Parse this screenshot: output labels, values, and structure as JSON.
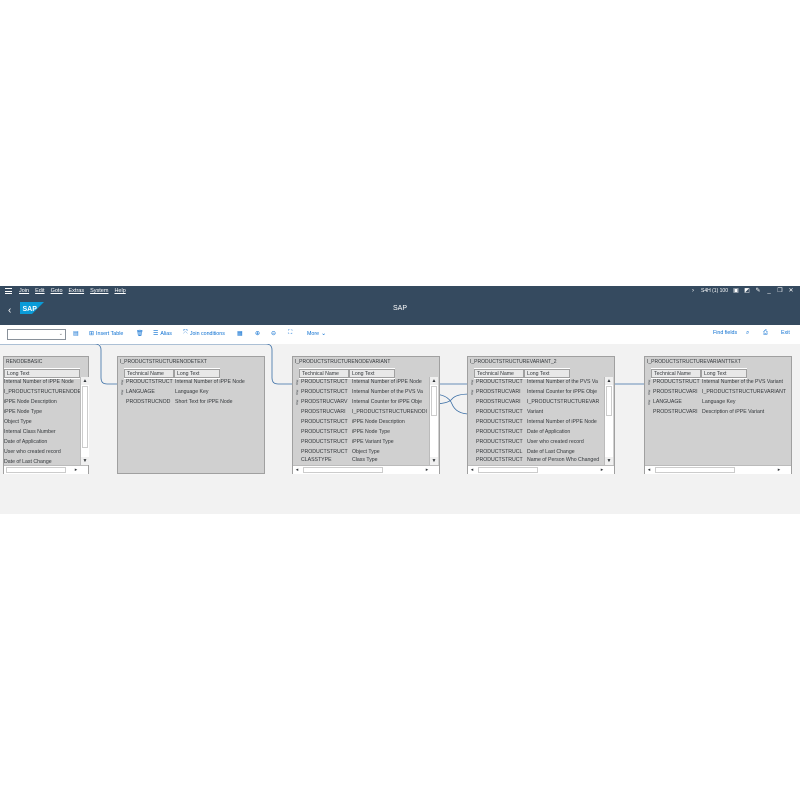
{
  "menubar": {
    "items": [
      "Join",
      "Edit",
      "Goto",
      "Extras",
      "System",
      "Help"
    ],
    "system_info": "S4H (1) 100",
    "colors": {
      "shell": "#354a5f",
      "text": "#ffffff"
    }
  },
  "titlebar": {
    "logo_text": "SAP",
    "title": "SAP"
  },
  "toolbar": {
    "insert_table": "Insert Table",
    "alias": "Alias",
    "join_conditions": "Join conditions",
    "more": "More",
    "find_fields": "Find fields",
    "exit": "Exit"
  },
  "tables": [
    {
      "name": "RENODEBASIC",
      "col1": "",
      "col2": "Long Text",
      "rows": [
        {
          "key": false,
          "tech": "",
          "text": "Internal Number of iPPE Node"
        },
        {
          "key": false,
          "tech": "",
          "text": "I_PRODUCTSTRUCTURENODE"
        },
        {
          "key": false,
          "tech": "",
          "text": "iPPE Node Description"
        },
        {
          "key": false,
          "tech": "",
          "text": "iPPE Node Type"
        },
        {
          "key": false,
          "tech": "",
          "text": "Object Type"
        },
        {
          "key": false,
          "tech": "",
          "text": "Internal Class Number"
        },
        {
          "key": false,
          "tech": "",
          "text": "Date of Application"
        },
        {
          "key": false,
          "tech": "",
          "text": "User who created record"
        },
        {
          "key": false,
          "tech": "",
          "text": "Date of Last Change"
        }
      ]
    },
    {
      "name": "I_PRODUCTSTRUCTURENODETEXT",
      "col1": "Technical Name",
      "col2": "Long Text",
      "rows": [
        {
          "key": true,
          "tech": "PRODUCTSTRUCT",
          "text": "Internal Number of iPPE Node"
        },
        {
          "key": true,
          "tech": "LANGUAGE",
          "text": "Language Key"
        },
        {
          "key": false,
          "tech": "PRODSTRUCNOD",
          "text": "Short Text for iPPE Node"
        }
      ]
    },
    {
      "name": "I_PRODUCTSTRUCTURENODEVARIANT",
      "col1": "Technical Name",
      "col2": "Long Text",
      "rows": [
        {
          "key": true,
          "tech": "PRODUCTSTRUCT",
          "text": "Internal Number of iPPE Node"
        },
        {
          "key": true,
          "tech": "PRODUCTSTRUCT",
          "text": "Internal Number of the PVS Va"
        },
        {
          "key": true,
          "tech": "PRODSTRUCVARV",
          "text": "Internal Counter for iPPE Obje"
        },
        {
          "key": false,
          "tech": "PRODSTRUCVARI",
          "text": "I_PRODUCTSTRUCTURENODI"
        },
        {
          "key": false,
          "tech": "PRODUCTSTRUCT",
          "text": "iPPE Node Description"
        },
        {
          "key": false,
          "tech": "PRODUCTSTRUCT",
          "text": "iPPE Node Type"
        },
        {
          "key": false,
          "tech": "PRODUCTSTRUCT",
          "text": "iPPE Variant Type"
        },
        {
          "key": false,
          "tech": "PRODUCTSTRUCT",
          "text": "Object Type"
        },
        {
          "key": false,
          "tech": "CLASSTYPE",
          "text": "Class Type"
        }
      ]
    },
    {
      "name": "I_PRODUCTSTRUCTUREVARIANT_2",
      "col1": "Technical Name",
      "col2": "Long Text",
      "rows": [
        {
          "key": true,
          "tech": "PRODUCTSTRUCT",
          "text": "Internal Number of the PVS Va"
        },
        {
          "key": true,
          "tech": "PRODSTRUCVARI",
          "text": "Internal Counter for iPPE Obje"
        },
        {
          "key": false,
          "tech": "PRODSTRUCVARI",
          "text": "I_PRODUCTSTRUCTUREVAR"
        },
        {
          "key": false,
          "tech": "PRODUCTSTRUCT",
          "text": "Variant"
        },
        {
          "key": false,
          "tech": "PRODUCTSTRUCT",
          "text": "Internal Number of iPPE Node"
        },
        {
          "key": false,
          "tech": "PRODUCTSTRUCT",
          "text": "Date of Application"
        },
        {
          "key": false,
          "tech": "PRODUCTSTRUCT",
          "text": "User who created record"
        },
        {
          "key": false,
          "tech": "PRODUCTSTRUCL",
          "text": "Date of Last Change"
        },
        {
          "key": false,
          "tech": "PRODUCTSTRUCT",
          "text": "Name of Person Who Changed"
        }
      ]
    },
    {
      "name": "I_PRODUCTSTRUCTUREVARIANTTEXT",
      "col1": "Technical Name",
      "col2": "Long Text",
      "rows": [
        {
          "key": true,
          "tech": "PRODUCTSTRUCT",
          "text": "Internal Number of the PVS Variant"
        },
        {
          "key": true,
          "tech": "PRODSTRUCVARI",
          "text": "I_PRODUCTSTRUCTUREVARIANT"
        },
        {
          "key": true,
          "tech": "LANGUAGE",
          "text": "Language Key"
        },
        {
          "key": false,
          "tech": "PRODSTRUCVARI",
          "text": "Description of iPPE Variant"
        }
      ]
    }
  ]
}
